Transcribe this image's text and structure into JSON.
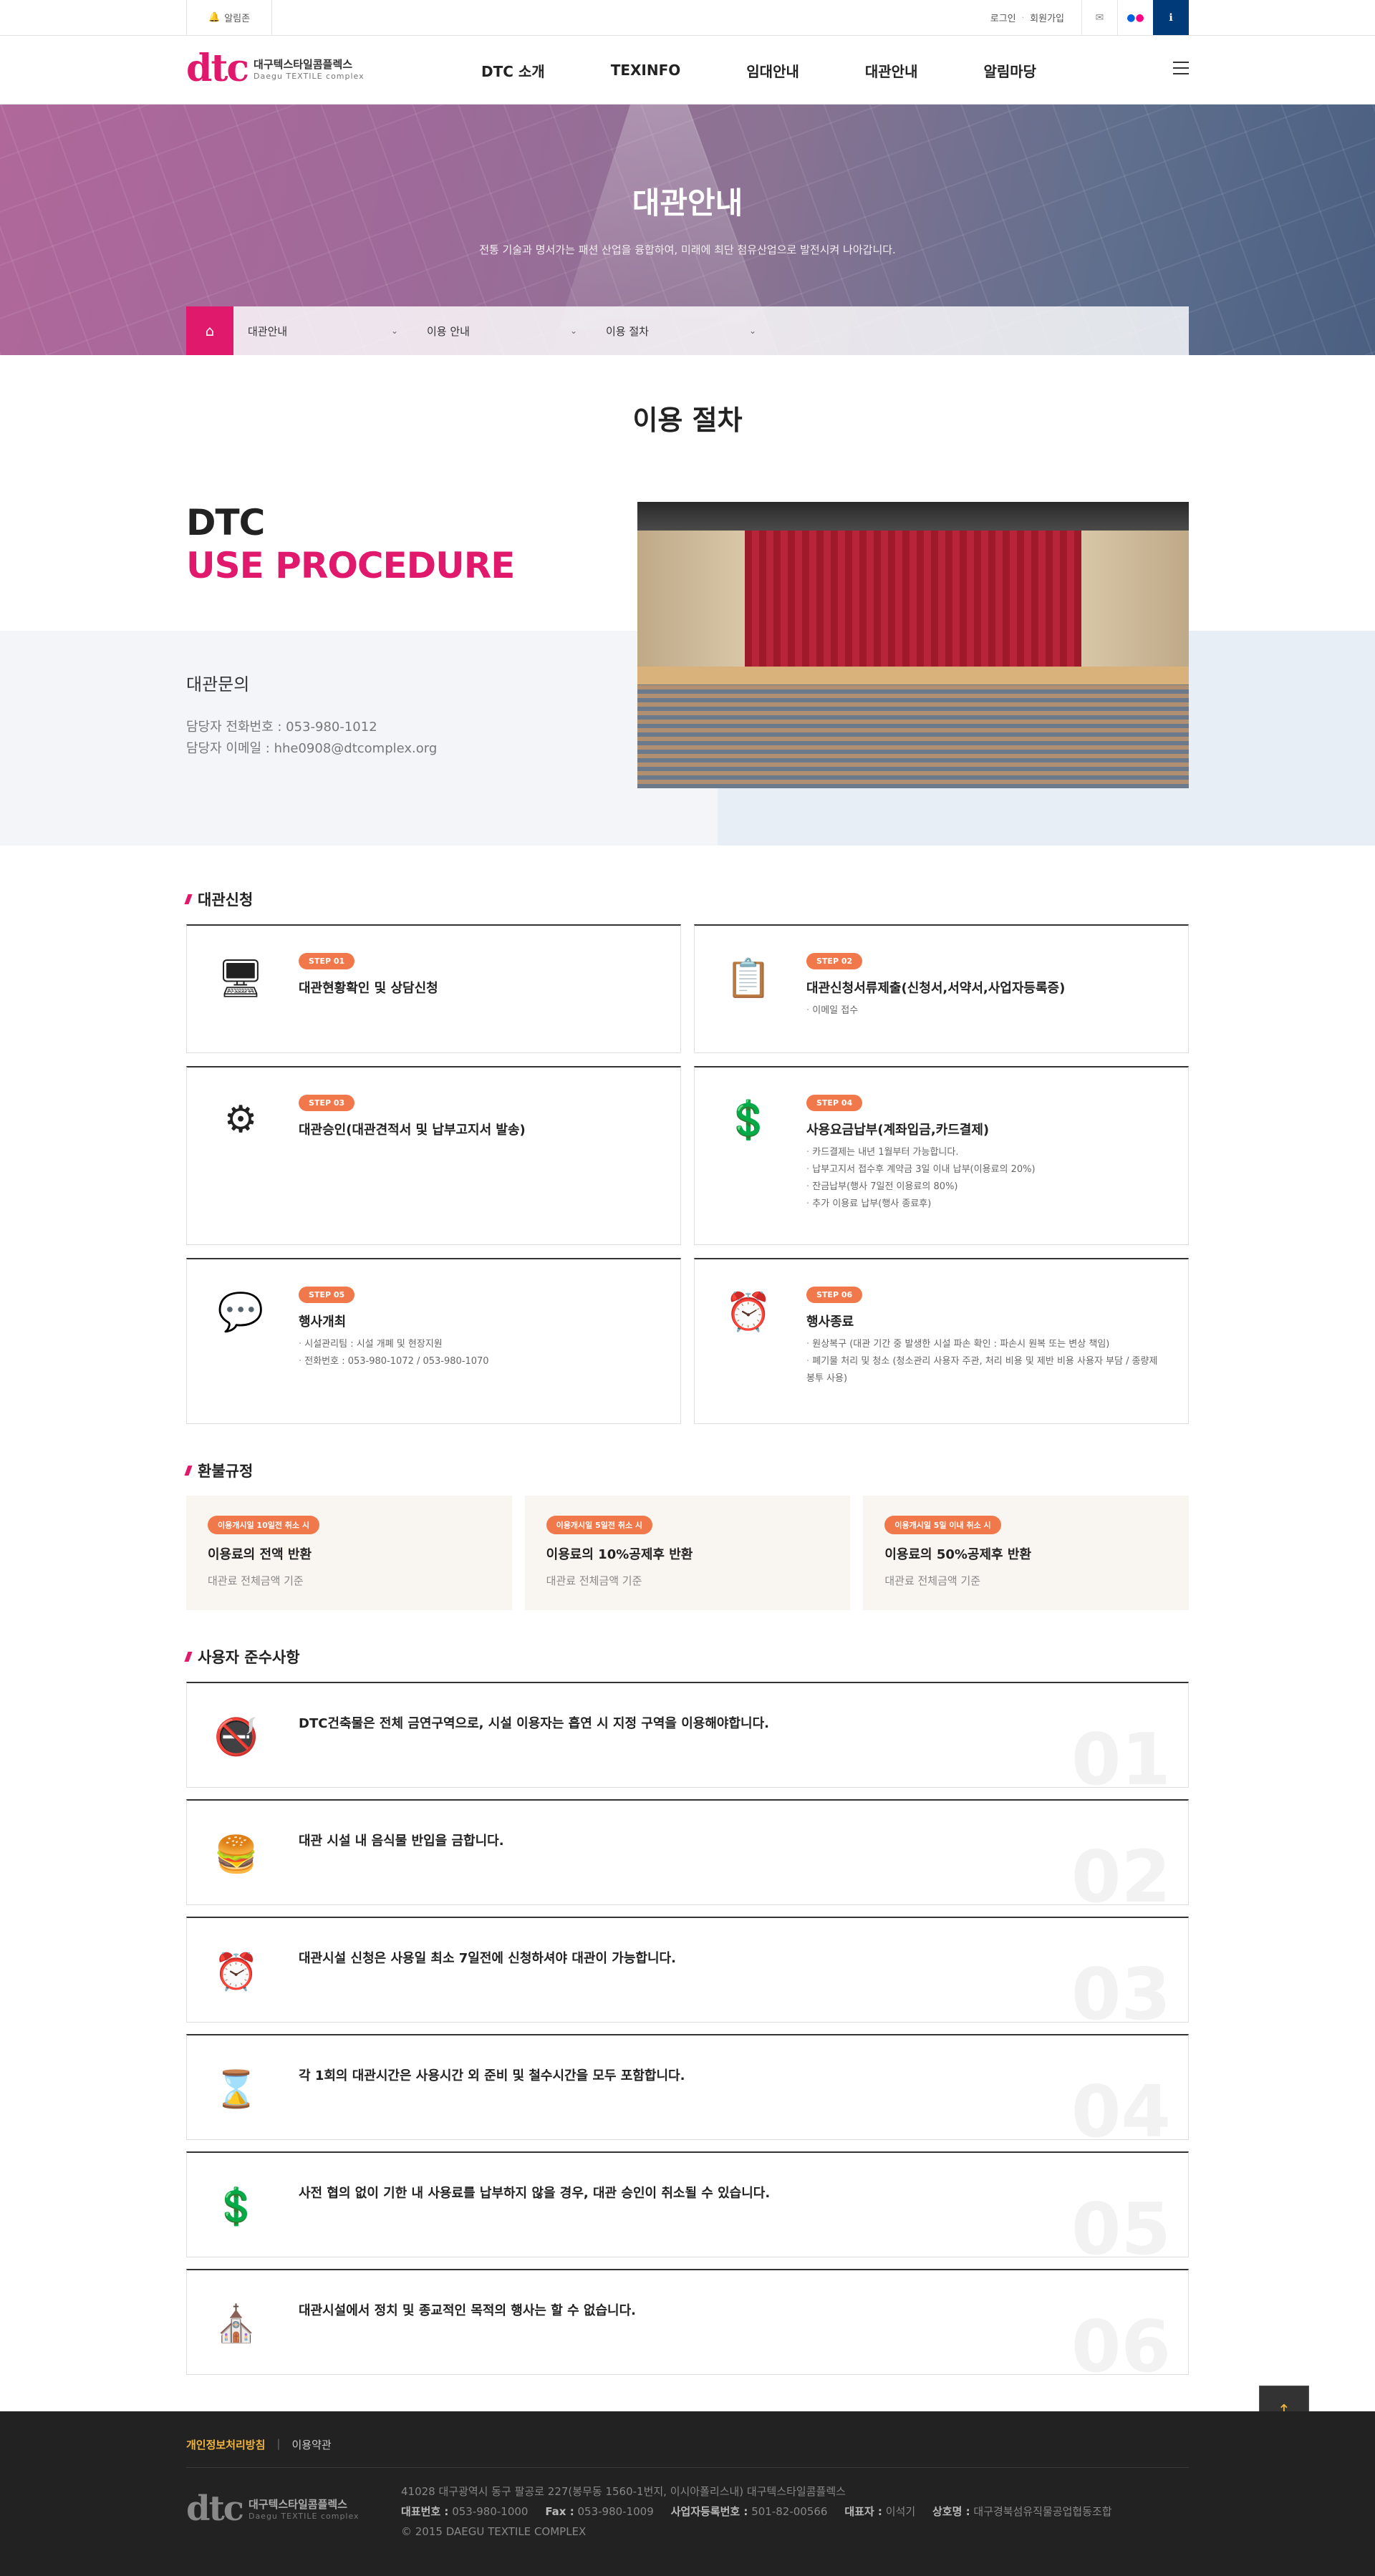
{
  "topbar": {
    "alarm": "알림존",
    "login": "로그인",
    "join": "회원가입"
  },
  "logo": {
    "mark": "dtc",
    "korean": "대구텍스타일콤플렉스",
    "english": "Daegu TEXTILE complex"
  },
  "nav": [
    "DTC 소개",
    "TEXINFO",
    "임대안내",
    "대관안내",
    "알림마당"
  ],
  "visual": {
    "title": "대관안내",
    "subtitle": "전통 기술과 명서가는 패션 산업을 융합하여, 미래에 최단 첨유산업으로 발전시켜 나아갑니다."
  },
  "breadcrumb": [
    "대관안내",
    "이용 안내",
    "이용 절차"
  ],
  "page_title": "이용 절차",
  "intro": {
    "line1": "DTC",
    "line2": "USE PROCEDURE",
    "contact_title": "대관문의",
    "tel": "담당자 전화번호 : 053-980-1012",
    "email": "담당자 이메일 : hhe0908@dtcomplex.org"
  },
  "apply": {
    "heading": "대관신청",
    "steps": [
      {
        "badge": "STEP 01",
        "icon": "monitor-icon",
        "glyph": "🖥",
        "title": "대관현황확인 및 상담신청",
        "items": []
      },
      {
        "badge": "STEP 02",
        "icon": "document-icon",
        "glyph": "📋",
        "title": "대관신청서류제출(신청서,서약서,사업자등록증)",
        "items": [
          "이메일 접수"
        ]
      },
      {
        "badge": "STEP 03",
        "icon": "gear-icon",
        "glyph": "⚙",
        "title": "대관승인(대관견적서 및 납부고지서 발송)",
        "items": []
      },
      {
        "badge": "STEP 04",
        "icon": "payment-hand-icon",
        "glyph": "💲",
        "title": "사용요금납부(계좌입금,카드결제)",
        "items": [
          "카드결제는 내년 1월부터 가능합니다.",
          "납부고지서 접수후 계약금 3일 이내 납부(이용료의 20%)",
          "잔금납부(행사 7일전 이용료의 80%)",
          "추가 이용료 납부(행사 종료후)"
        ]
      },
      {
        "badge": "STEP 05",
        "icon": "event-icon",
        "glyph": "💬",
        "title": "행사개최",
        "items": [
          "시설관리팀 : 시설 개폐 및 현장지원",
          "전화번호 : 053-980-1072 / 053-980-1070"
        ]
      },
      {
        "badge": "STEP 06",
        "icon": "clock-icon",
        "glyph": "⏰",
        "title": "행사종료",
        "items": [
          "원상복구 (대관 기간 중 발생한 시설 파손 확인 : 파손시 원복 또는 변상 책임)",
          "폐기물 처리 및 청소 (청소관리 사용자 주관, 처리 비용 및 제반 비용 사용자 부담 / 종량제 봉투 사용)"
        ]
      }
    ]
  },
  "refund": {
    "heading": "환불규정",
    "items": [
      {
        "badge": "이용개시일 10일전 취소 시",
        "title": "이용료의 전액 반환",
        "sub": "대관료 전체금액 기준"
      },
      {
        "badge": "이용개시일 5일전 취소 시",
        "title": "이용료의 10%공제후 반환",
        "sub": "대관료 전체금액 기준"
      },
      {
        "badge": "이용개시일 5일 이내 취소 시",
        "title": "이용료의 50%공제후 반환",
        "sub": "대관료 전체금액 기준"
      }
    ]
  },
  "rules": {
    "heading": "사용자 준수사항",
    "items": [
      {
        "icon": "no-smoking-icon",
        "glyph": "🚭",
        "text": "DTC건축물은 전체 금연구역으로, 시설 이용자는 흡연 시 지정 구역을 이용해야합니다.",
        "num": "01"
      },
      {
        "icon": "no-food-icon",
        "glyph": "🍔",
        "text": "대관 시설 내 음식물 반입을 금합니다.",
        "num": "02"
      },
      {
        "icon": "clock-icon",
        "glyph": "⏰",
        "text": "대관시설 신청은 사용일 최소 7일전에 신청하셔야 대관이 가능합니다.",
        "num": "03"
      },
      {
        "icon": "hourglass-icon",
        "glyph": "⌛",
        "text": "각 1회의 대관시간은 사용시간 외 준비 및 철수시간을 모두 포함합니다.",
        "num": "04"
      },
      {
        "icon": "payment-hand-icon",
        "glyph": "💲",
        "text": "사전 협의 없이 기한 내 사용료를 납부하지 않을 경우, 대관 승인이 취소될 수 있습니다.",
        "num": "05"
      },
      {
        "icon": "church-icon",
        "glyph": "⛪",
        "text": "대관시설에서 정치 및 종교적인 목적의 행사는 할 수 없습니다.",
        "num": "06"
      }
    ]
  },
  "footer": {
    "privacy": "개인정보처리방침",
    "terms": "이용약관",
    "address": "41028 대구광역시 동구 팔공로 227(봉무동 1560-1번지, 이시아폴리스내) 대구텍스타일콤플렉스",
    "tel_label": "대표번호 :",
    "tel": "053-980-1000",
    "fax_label": "Fax :",
    "fax": "053-980-1009",
    "biz_label": "사업자등록번호 :",
    "biz": "501-82-00566",
    "ceo_label": "대표자 :",
    "ceo": "이석기",
    "name_label": "상호명 :",
    "name": "대구경북섬유직물공업협동조합",
    "copyright": "© 2015 DAEGU TEXTILE COMPLEX"
  }
}
